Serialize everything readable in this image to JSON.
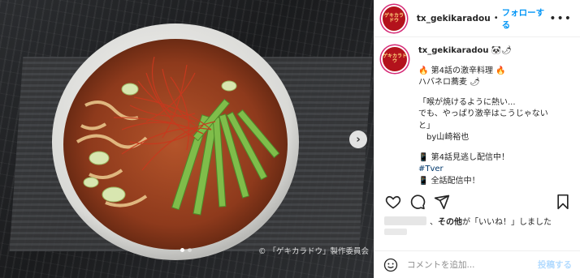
{
  "media": {
    "credit": "© 「ゲキカラドウ」製作委員会",
    "slides": 2,
    "active_slide": 1,
    "next_icon": "chevron-right-icon"
  },
  "header": {
    "avatar_text": "ゲキカラドウ",
    "username": "tx_gekikaradou",
    "separator": "•",
    "follow_label": "フォローする",
    "more_icon": "more-horizontal-icon"
  },
  "caption": {
    "username": "tx_gekikaradou",
    "username_suffix": " 🐼🌶",
    "lines": [
      "🔥 第4話の激辛料理 🔥",
      "ハバネロ蕎麦 🌶",
      "",
      "「喉が焼けるように熱い...",
      "でも、やっぱり激辛はこうじゃない",
      "と」",
      "　by山崎裕也",
      "",
      "📱 第4話見逃し配信中！"
    ],
    "hashtag": "#Tver",
    "cut_line": "📱 全話配信中！"
  },
  "actions": {
    "icons": [
      "heart-icon",
      "comment-icon",
      "share-icon",
      "bookmark-icon"
    ]
  },
  "likes": {
    "middle": "、",
    "bold": "その他",
    "rest": "が「いいね！」しました"
  },
  "comment": {
    "placeholder": "コメントを追加...",
    "post_label": "投稿する",
    "emoji_icon": "emoji-icon"
  },
  "colors": {
    "accent": "#0095f6",
    "post_disabled": "#b3dbff",
    "avatar_bg": "#b3121c"
  }
}
